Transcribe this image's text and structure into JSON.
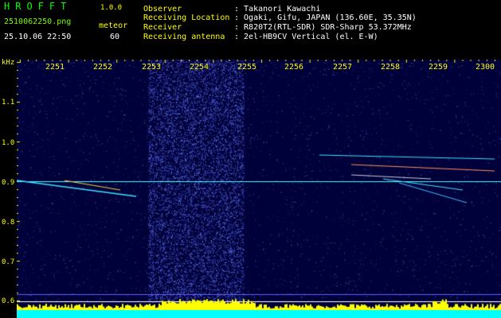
{
  "header": {
    "logo": "HROFFT",
    "version": "1.0.0",
    "filename": "2510062250.png",
    "mode": "meteor",
    "timestamp": "25.10.06 22:50",
    "count": "60",
    "fields": [
      {
        "label": "Observer",
        "value": ": Takanori Kawachi"
      },
      {
        "label": "Receiving Location",
        "value": ": Ogaki, Gifu, JAPAN (136.60E, 35.35N)"
      },
      {
        "label": "Receiver",
        "value": ": R820T2(RTL-SDR) SDR-Sharp 53.372MHz"
      },
      {
        "label": "Receiving antenna",
        "value": ": 2el-HB9CV Vertical (el. E-W)"
      }
    ]
  },
  "axes": {
    "y_unit": "kHz",
    "y_ticks": [
      "1.1",
      "1.0",
      "0.9",
      "0.8",
      "0.7",
      "0.6"
    ],
    "x_ticks": [
      "2251",
      "2252",
      "2253",
      "2254",
      "2255",
      "2256",
      "2257",
      "2258",
      "2259",
      "2300"
    ]
  },
  "colors": {
    "tick_yellow": "#ffff00",
    "carrier": "#44ffff",
    "level": "#00ffff"
  }
}
